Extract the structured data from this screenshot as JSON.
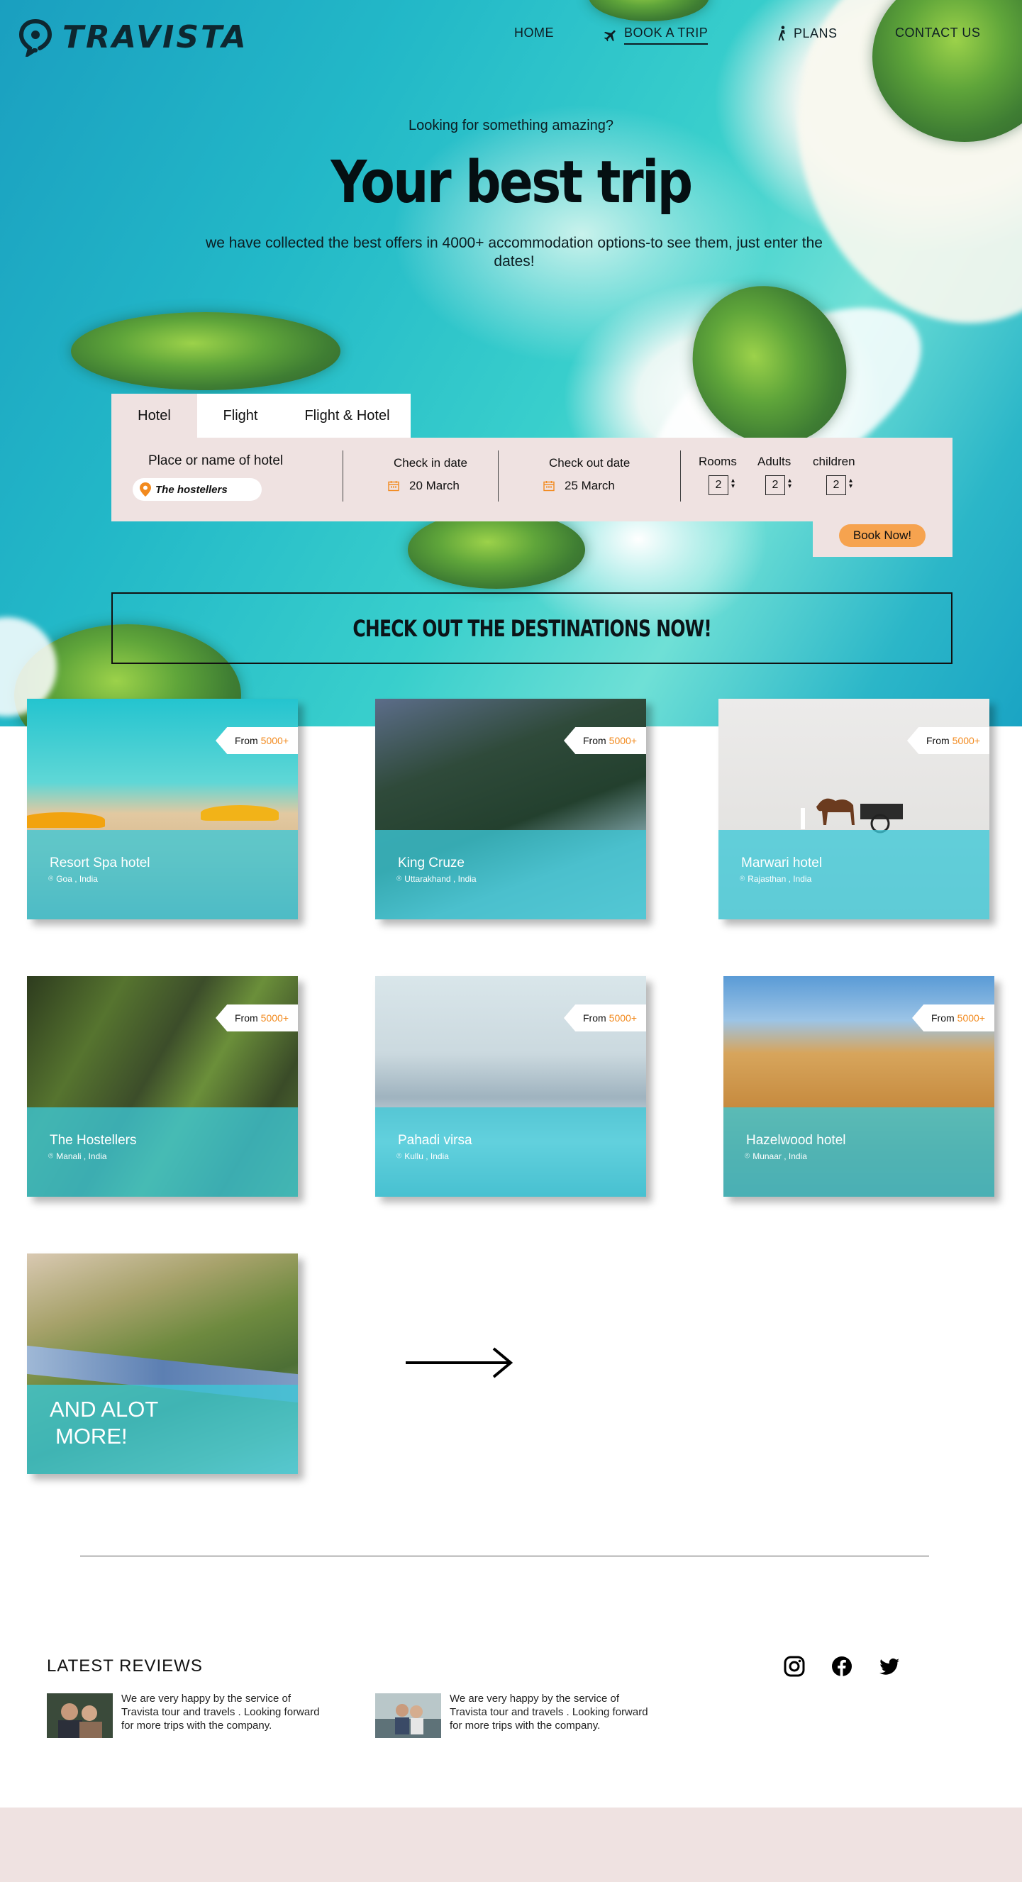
{
  "brand": {
    "name": "TRAVISTA"
  },
  "nav": {
    "home": "HOME",
    "book_trip": "BOOK A TRIP",
    "plans": "PLANS",
    "contact": "CONTACT US"
  },
  "hero": {
    "kicker": "Looking for something amazing?",
    "title": "Your best trip",
    "subtitle": "we have collected the best offers in 4000+ accommodation options-to see them, just enter the dates!"
  },
  "booking": {
    "tabs": [
      "Hotel",
      "Flight",
      "Flight & Hotel"
    ],
    "active_tab": "Hotel",
    "place_label": "Place or name of hotel",
    "place_value": "The hostellers",
    "checkin_label": "Check in date",
    "checkin_value": "20 March",
    "checkout_label": "Check out date",
    "checkout_value": "25 March",
    "rooms_label": "Rooms",
    "rooms_value": "2",
    "adults_label": "Adults",
    "adults_value": "2",
    "children_label": "children",
    "children_value": "2",
    "book_button": "Book Now!"
  },
  "cta": "CHECK OUT THE DESTINATIONS NOW!",
  "cards": [
    {
      "name": "Resort Spa hotel",
      "location": "Goa , India",
      "from": "From",
      "price": "5000+"
    },
    {
      "name": "King Cruze",
      "location": "Uttarakhand , India",
      "from": "From",
      "price": "5000+"
    },
    {
      "name": "Marwari hotel",
      "location": "Rajasthan , India",
      "from": "From",
      "price": "5000+"
    },
    {
      "name": "The Hostellers",
      "location": "Manali , India",
      "from": "From",
      "price": "5000+"
    },
    {
      "name": "Pahadi virsa",
      "location": "Kullu , India",
      "from": "From",
      "price": "5000+"
    },
    {
      "name": "Hazelwood hotel",
      "location": "Munaar , India",
      "from": "From",
      "price": "5000+"
    }
  ],
  "more_card": {
    "line1": "AND ALOT",
    "line2": "MORE!"
  },
  "reviews": {
    "title": "LATEST  REVIEWS",
    "items": [
      {
        "text": "We are very happy by the service of Travista tour and travels . Looking forward for more trips with the company."
      },
      {
        "text": "We are very happy by the service of Travista tour and travels . Looking forward for more trips with the company."
      }
    ]
  },
  "social": [
    "instagram-icon",
    "facebook-icon",
    "twitter-icon"
  ],
  "colors": {
    "accent": "#f6a34f",
    "price": "#f28a1e",
    "panel": "#efe2e1",
    "card_overlay": "#3cc8d7"
  }
}
